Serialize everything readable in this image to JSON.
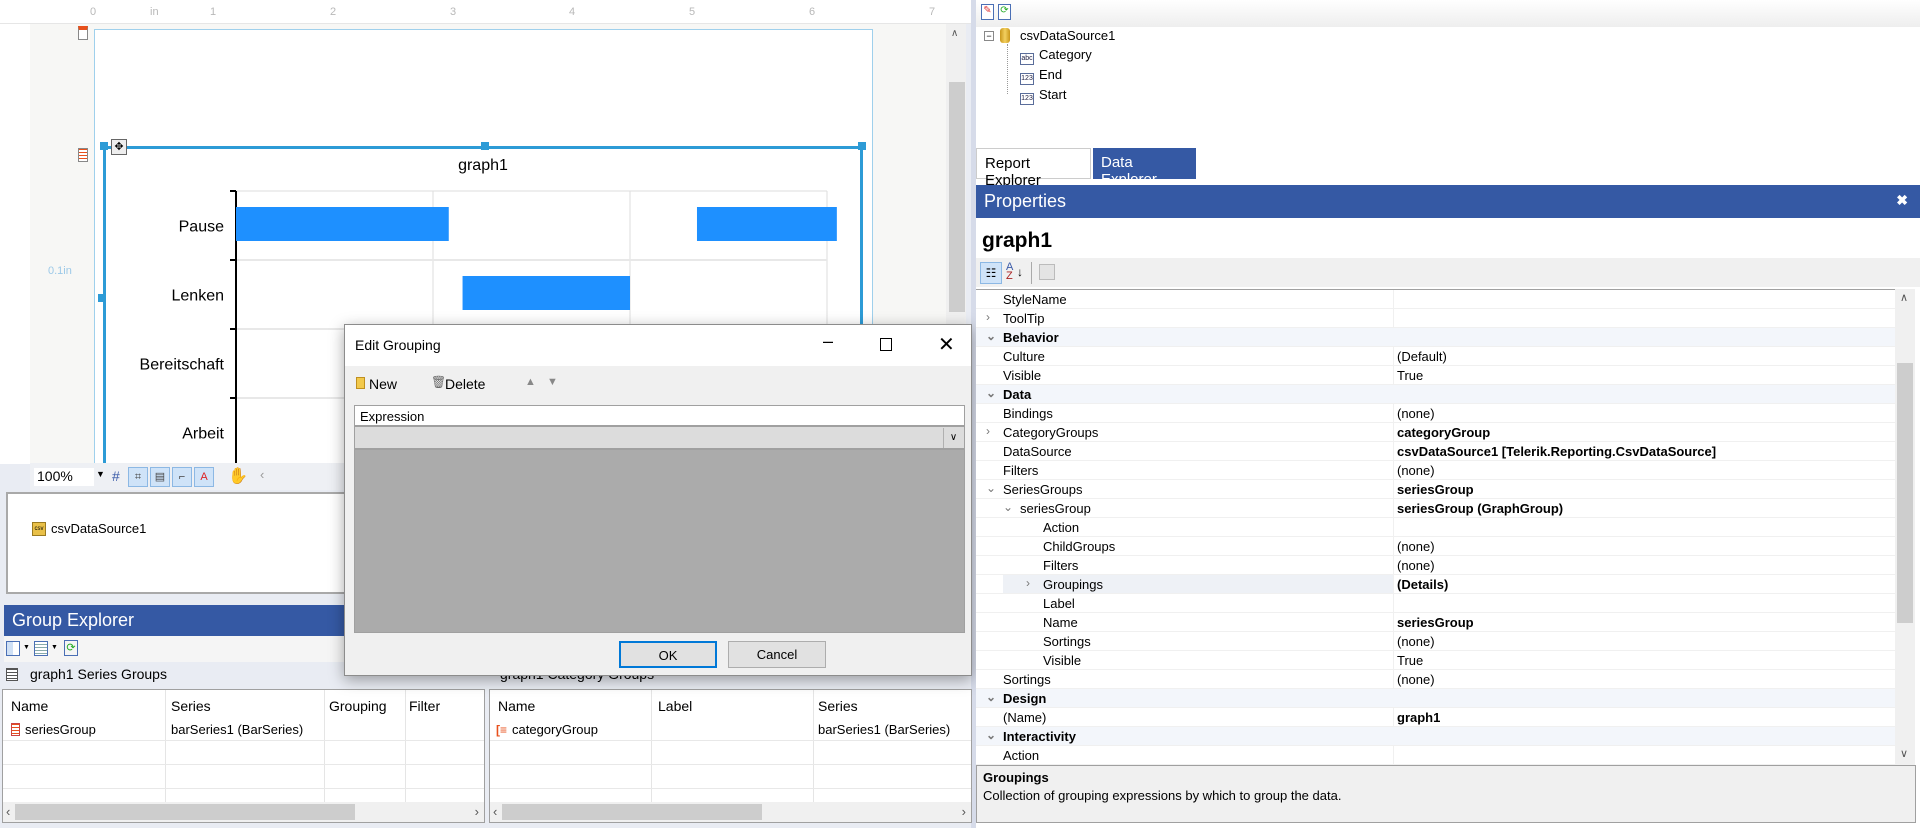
{
  "designer": {
    "ruler_labels": [
      "0",
      "in",
      "1",
      "2",
      "3",
      "4",
      "5",
      "6",
      "7"
    ],
    "margin_label": "0.1in",
    "zoom": "100%"
  },
  "chart_data": {
    "type": "bar",
    "orientation": "horizontal-range",
    "title": "graph1",
    "categories": [
      "Pause",
      "Lenken",
      "Bereitschaft",
      "Arbeit"
    ],
    "series": [
      {
        "values": [
          {
            "category": "Pause",
            "start": 0.0,
            "end": 1.08
          },
          {
            "category": "Pause",
            "start": 2.34,
            "end": 3.05
          },
          {
            "category": "Lenken",
            "start": 1.15,
            "end": 2.0
          }
        ]
      }
    ],
    "xlim": [
      0,
      3
    ],
    "grid": true,
    "bar_color": "#1e90ff"
  },
  "tray": {
    "datasource": "csvDataSource1"
  },
  "group_explorer": {
    "title": "Group Explorer",
    "series_caption": "graph1 Series Groups",
    "category_caption": "graph1 Category Groups",
    "series_table": {
      "headers": [
        "Name",
        "Series",
        "Grouping",
        "Filter"
      ],
      "row": [
        "seriesGroup",
        "barSeries1 (BarSeries)",
        "",
        ""
      ]
    },
    "category_table": {
      "headers": [
        "Name",
        "Label",
        "Series"
      ],
      "row": [
        "categoryGroup",
        "",
        "barSeries1 (BarSeries)"
      ]
    }
  },
  "dialog": {
    "title": "Edit Grouping",
    "new_label": "New",
    "delete_label": "Delete",
    "column_header": "Expression",
    "expression_value": "",
    "ok_label": "OK",
    "cancel_label": "Cancel"
  },
  "data_explorer": {
    "root": "csvDataSource1",
    "fields": [
      {
        "name": "Category",
        "type": "abc"
      },
      {
        "name": "End",
        "type": "123"
      },
      {
        "name": "Start",
        "type": "123"
      }
    ],
    "tabs": [
      "Report Explorer",
      "Data Explorer"
    ],
    "active_tab": "Data Explorer"
  },
  "properties": {
    "header": "Properties",
    "object_name": "graph1",
    "rows": [
      {
        "name": "StyleName",
        "value": "",
        "level": 0
      },
      {
        "name": "ToolTip",
        "value": "",
        "level": 0,
        "arrow": ">"
      },
      {
        "name": "Behavior",
        "cat": true,
        "arrow": "v"
      },
      {
        "name": "Culture",
        "value": "(Default)",
        "level": 0
      },
      {
        "name": "Visible",
        "value": "True",
        "level": 0
      },
      {
        "name": "Data",
        "cat": true,
        "arrow": "v"
      },
      {
        "name": "Bindings",
        "value": "(none)",
        "level": 0
      },
      {
        "name": "CategoryGroups",
        "value": "categoryGroup",
        "level": 0,
        "arrow": ">",
        "bold": true
      },
      {
        "name": "DataSource",
        "value": "csvDataSource1 [Telerik.Reporting.CsvDataSource]",
        "level": 0,
        "bold": true
      },
      {
        "name": "Filters",
        "value": "(none)",
        "level": 0
      },
      {
        "name": "SeriesGroups",
        "value": "seriesGroup",
        "level": 0,
        "arrow": "v",
        "bold": true
      },
      {
        "name": "seriesGroup",
        "value": "seriesGroup (GraphGroup)",
        "level": 1,
        "arrow": "v",
        "bold": true
      },
      {
        "name": "Action",
        "value": "",
        "level": 2
      },
      {
        "name": "ChildGroups",
        "value": "(none)",
        "level": 2
      },
      {
        "name": "Filters",
        "value": "(none)",
        "level": 2
      },
      {
        "name": "Groupings",
        "value": "(Details)",
        "level": 2,
        "arrow": ">",
        "bold": true,
        "selected": true
      },
      {
        "name": "Label",
        "value": "",
        "level": 2
      },
      {
        "name": "Name",
        "value": "seriesGroup",
        "level": 2,
        "bold": true
      },
      {
        "name": "Sortings",
        "value": "(none)",
        "level": 2
      },
      {
        "name": "Visible",
        "value": "True",
        "level": 2
      },
      {
        "name": "Sortings",
        "value": "(none)",
        "level": 0
      },
      {
        "name": "Design",
        "cat": true,
        "arrow": "v"
      },
      {
        "name": "(Name)",
        "value": "graph1",
        "level": 0,
        "bold": true
      },
      {
        "name": "Interactivity",
        "cat": true,
        "arrow": "v"
      },
      {
        "name": "Action",
        "value": "",
        "level": 0
      }
    ],
    "description_title": "Groupings",
    "description_text": "Collection of grouping expressions by which to group the data."
  },
  "colors": {
    "panel_header": "#3559a4",
    "selection": "#2d9bd6",
    "accent_button": "#0078d7"
  }
}
